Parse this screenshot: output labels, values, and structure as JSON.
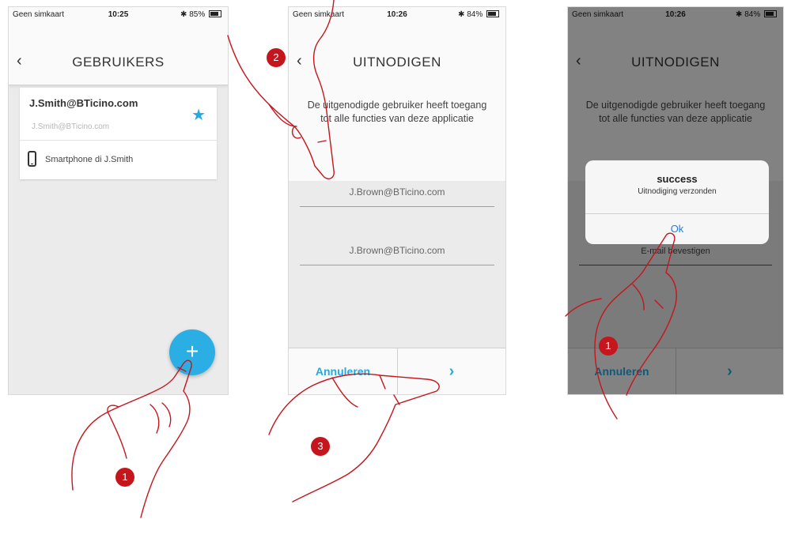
{
  "screens": [
    {
      "status": {
        "carrier": "Geen simkaart",
        "time": "10:25",
        "battery": "85%"
      },
      "title": "GEBRUIKERS",
      "user": {
        "email": "J.Smith@BTicino.com",
        "sub_email": "J.Smith@BTicino.com",
        "device": "Smartphone di J.Smith"
      },
      "fab_label": "+"
    },
    {
      "status": {
        "carrier": "Geen simkaart",
        "time": "10:26",
        "battery": "84%"
      },
      "title": "UITNODIGEN",
      "info": "De uitgenodigde gebruiker heeft toegang tot alle functies van deze applicatie",
      "email_field": "J.Brown@BTicino.com",
      "confirm_field": "J.Brown@BTicino.com",
      "cancel": "Annuleren",
      "next": "›"
    },
    {
      "status": {
        "carrier": "Geen simkaart",
        "time": "10:26",
        "battery": "84%"
      },
      "title": "UITNODIGEN",
      "info": "De uitgenodigde gebruiker heeft toegang tot alle functies van deze applicatie",
      "confirm_placeholder": "E-mail bevestigen",
      "cancel": "Annuleren",
      "next": "›",
      "alert": {
        "title": "success",
        "message": "Uitnodiging verzonden",
        "ok": "Ok"
      }
    }
  ],
  "back_icon": "‹",
  "steps": {
    "s1": "1",
    "s2": "2",
    "s3": "3",
    "s4": "1"
  },
  "colors": {
    "accent": "#26a9e0",
    "step": "#c4161c",
    "hand": "#c4161c"
  }
}
